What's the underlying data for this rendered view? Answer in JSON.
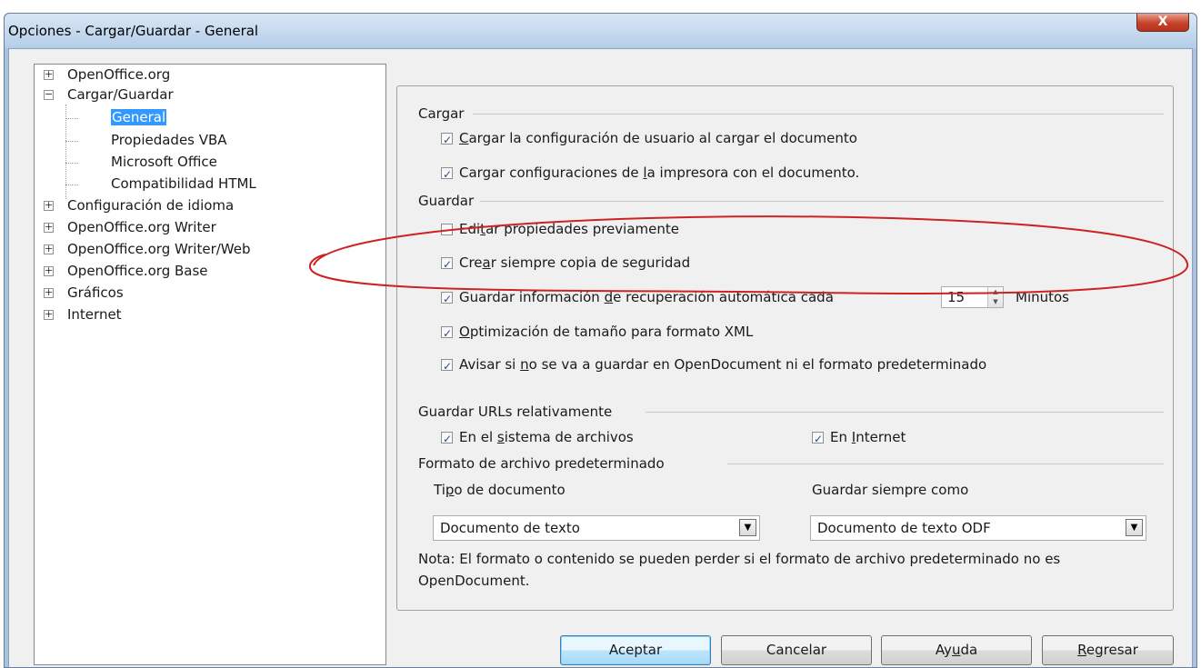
{
  "window": {
    "title": "Opciones - Cargar/Guardar - General",
    "close_label": "X"
  },
  "tree": {
    "items": [
      {
        "label": "OpenOffice.org",
        "expander": "+"
      },
      {
        "label": "Cargar/Guardar",
        "expander": "−"
      },
      {
        "label": "General",
        "selected": true
      },
      {
        "label": "Propiedades VBA"
      },
      {
        "label": "Microsoft Office"
      },
      {
        "label": "Compatibilidad HTML"
      },
      {
        "label": "Configuración de idioma",
        "expander": "+"
      },
      {
        "label": "OpenOffice.org Writer",
        "expander": "+"
      },
      {
        "label": "OpenOffice.org Writer/Web",
        "expander": "+"
      },
      {
        "label": "OpenOffice.org Base",
        "expander": "+"
      },
      {
        "label": "Gráficos",
        "expander": "+"
      },
      {
        "label": "Internet",
        "expander": "+"
      }
    ]
  },
  "cargar": {
    "heading": "Cargar",
    "opt1": {
      "pre": "",
      "acc": "C",
      "post": "argar la configuración de usuario al cargar el documento",
      "checked": true
    },
    "opt2": {
      "pre": "Cargar configuraciones de ",
      "acc": "l",
      "post": "a impresora con el documento.",
      "checked": true
    }
  },
  "guardar": {
    "heading": "Guardar",
    "opt1": {
      "pre": "Edi",
      "acc": "t",
      "post": "ar propiedades previamente",
      "checked": false
    },
    "opt2": {
      "pre": "Cre",
      "acc": "a",
      "post": "r siempre copia de seguridad",
      "checked": true
    },
    "opt3": {
      "pre": "Guardar información ",
      "acc": "d",
      "post": "e recuperación automática cada",
      "checked": true
    },
    "autosave_minutes": "15",
    "minutes_label": "Minutos",
    "opt4": {
      "pre": "",
      "acc": "O",
      "post": "ptimización de tamaño para formato XML",
      "checked": true
    },
    "opt5": {
      "pre": "Avisar si ",
      "acc": "n",
      "post": "o se va a guardar en OpenDocument ni el formato predeterminado",
      "checked": true
    }
  },
  "urls": {
    "heading": "Guardar URLs relativamente",
    "filesystem": {
      "pre": "En el ",
      "acc": "s",
      "post": "istema de archivos",
      "checked": true
    },
    "internet": {
      "pre": "En ",
      "acc": "I",
      "post": "nternet",
      "checked": true
    }
  },
  "formato": {
    "heading": "Formato de archivo predeterminado",
    "doctype_label": {
      "pre": "Ti",
      "acc": "p",
      "post": "o de documento"
    },
    "saveas_label": "Guardar siempre como",
    "doctype_value": "Documento de texto",
    "saveas_value": "Documento de texto ODF",
    "note": "Nota: El formato o contenido se pueden perder si el formato de archivo predeterminado no es OpenDocument."
  },
  "buttons": {
    "ok": "Aceptar",
    "cancel": "Cancelar",
    "help": {
      "pre": "Ay",
      "acc": "u",
      "post": "da"
    },
    "back": {
      "pre": "",
      "acc": "R",
      "post": "egresar"
    }
  },
  "colors": {
    "annotation": "#cc2222",
    "selection": "#3399ff"
  }
}
